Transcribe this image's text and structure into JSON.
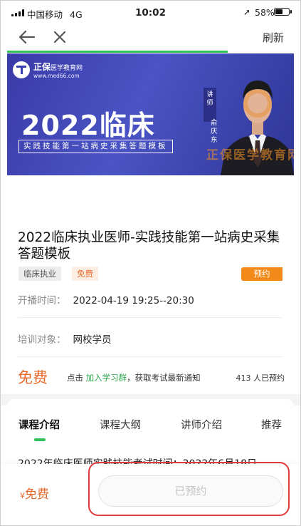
{
  "status_bar": {
    "carrier": "中国移动",
    "network": "4G",
    "time": "10:02",
    "battery": "58%",
    "battery_level": 0.58
  },
  "nav": {
    "refresh_label": "刷新"
  },
  "banner": {
    "logo_name": "正保",
    "logo_sub": "医学教育网",
    "logo_url": "www.med66.com",
    "title": "2022临床",
    "subtitle": "实践技能第一站病史采集答题模板",
    "lecturer_tag": "讲师",
    "lecturer_name": "俞庆东",
    "watermark": "正保医学教育网"
  },
  "course": {
    "title": "2022临床执业医师-实践技能第一站病史采集答题模板",
    "tags": [
      "临床执业",
      "免费"
    ],
    "status_badge": "预约",
    "time_label": "开播时间：",
    "time_value": "2022-04-19 19:25--20:30",
    "target_label": "培训对象：",
    "target_value": "网校学员",
    "price": "免费",
    "notice_prefix": "点击",
    "notice_link": "加入学习群",
    "notice_suffix": "，获取考试最新通知",
    "reserve_count": "413 人已预约"
  },
  "tabs": [
    {
      "label": "课程介绍",
      "active": true
    },
    {
      "label": "课程大纲",
      "active": false
    },
    {
      "label": "讲师介绍",
      "active": false
    },
    {
      "label": "推荐",
      "active": false
    }
  ],
  "content_preview": "2022年临床医师实践技能考试时间：2022年6月18日",
  "bottom_bar": {
    "currency": "¥",
    "price": "免费",
    "reserved_label": "已预约"
  },
  "colors": {
    "accent_green": "#2fbf58",
    "price_orange": "#e8692a",
    "badge_orange": "#f28a1a",
    "banner_blue": "#3a3aa8",
    "highlight_red": "#e03a3a"
  }
}
